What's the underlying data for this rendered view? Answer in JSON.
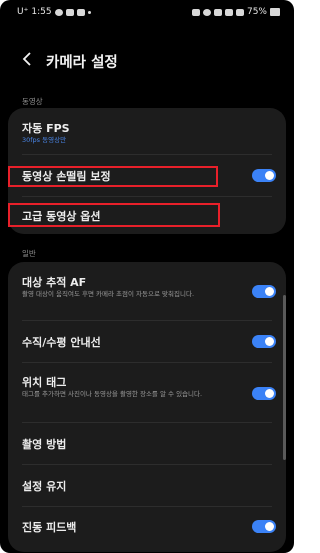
{
  "status_bar": {
    "carrier": "U⁺",
    "time": "1:55",
    "battery": "75%"
  },
  "header": {
    "back_icon": "chevron-left-icon",
    "title": "카메라 설정"
  },
  "sections": {
    "video_label": "동영상",
    "general_label": "일반"
  },
  "video": {
    "auto_fps_title": "자동 FPS",
    "auto_fps_sub": "30fps 동영상만",
    "stabilization_title": "동영상 손떨림 보정",
    "stabilization_on": true,
    "advanced_title": "고급 동영상 옵션"
  },
  "general": {
    "tracking_af_title": "대상 추적 AF",
    "tracking_af_sub": "촬영 대상이 움직여도 후면 카메라 초점이 자동으로 맞춰집니다.",
    "tracking_af_on": true,
    "grid_title": "수직/수평 안내선",
    "grid_on": true,
    "location_title": "위치 태그",
    "location_sub": "태그를 추가하면 사진이나 동영상을 촬영한 장소를 알 수 있습니다.",
    "location_on": true,
    "shooting_methods_title": "촬영 방법",
    "keep_settings_title": "설정 유지",
    "vibration_title": "진동 피드백",
    "vibration_on": true
  },
  "colors": {
    "accent": "#3b82f6",
    "highlight_box": "#e8202a",
    "background": "#000000",
    "card": "#1c1c1c"
  }
}
